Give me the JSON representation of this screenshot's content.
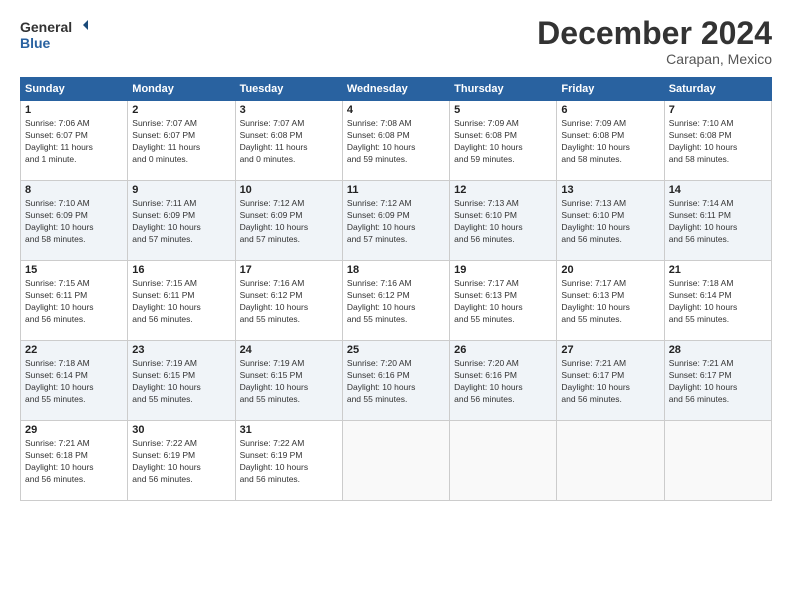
{
  "logo": {
    "line1": "General",
    "line2": "Blue"
  },
  "title": "December 2024",
  "subtitle": "Carapan, Mexico",
  "days_header": [
    "Sunday",
    "Monday",
    "Tuesday",
    "Wednesday",
    "Thursday",
    "Friday",
    "Saturday"
  ],
  "weeks": [
    [
      {
        "num": "1",
        "info": "Sunrise: 7:06 AM\nSunset: 6:07 PM\nDaylight: 11 hours\nand 1 minute."
      },
      {
        "num": "2",
        "info": "Sunrise: 7:07 AM\nSunset: 6:07 PM\nDaylight: 11 hours\nand 0 minutes."
      },
      {
        "num": "3",
        "info": "Sunrise: 7:07 AM\nSunset: 6:08 PM\nDaylight: 11 hours\nand 0 minutes."
      },
      {
        "num": "4",
        "info": "Sunrise: 7:08 AM\nSunset: 6:08 PM\nDaylight: 10 hours\nand 59 minutes."
      },
      {
        "num": "5",
        "info": "Sunrise: 7:09 AM\nSunset: 6:08 PM\nDaylight: 10 hours\nand 59 minutes."
      },
      {
        "num": "6",
        "info": "Sunrise: 7:09 AM\nSunset: 6:08 PM\nDaylight: 10 hours\nand 58 minutes."
      },
      {
        "num": "7",
        "info": "Sunrise: 7:10 AM\nSunset: 6:08 PM\nDaylight: 10 hours\nand 58 minutes."
      }
    ],
    [
      {
        "num": "8",
        "info": "Sunrise: 7:10 AM\nSunset: 6:09 PM\nDaylight: 10 hours\nand 58 minutes."
      },
      {
        "num": "9",
        "info": "Sunrise: 7:11 AM\nSunset: 6:09 PM\nDaylight: 10 hours\nand 57 minutes."
      },
      {
        "num": "10",
        "info": "Sunrise: 7:12 AM\nSunset: 6:09 PM\nDaylight: 10 hours\nand 57 minutes."
      },
      {
        "num": "11",
        "info": "Sunrise: 7:12 AM\nSunset: 6:09 PM\nDaylight: 10 hours\nand 57 minutes."
      },
      {
        "num": "12",
        "info": "Sunrise: 7:13 AM\nSunset: 6:10 PM\nDaylight: 10 hours\nand 56 minutes."
      },
      {
        "num": "13",
        "info": "Sunrise: 7:13 AM\nSunset: 6:10 PM\nDaylight: 10 hours\nand 56 minutes."
      },
      {
        "num": "14",
        "info": "Sunrise: 7:14 AM\nSunset: 6:11 PM\nDaylight: 10 hours\nand 56 minutes."
      }
    ],
    [
      {
        "num": "15",
        "info": "Sunrise: 7:15 AM\nSunset: 6:11 PM\nDaylight: 10 hours\nand 56 minutes."
      },
      {
        "num": "16",
        "info": "Sunrise: 7:15 AM\nSunset: 6:11 PM\nDaylight: 10 hours\nand 56 minutes."
      },
      {
        "num": "17",
        "info": "Sunrise: 7:16 AM\nSunset: 6:12 PM\nDaylight: 10 hours\nand 55 minutes."
      },
      {
        "num": "18",
        "info": "Sunrise: 7:16 AM\nSunset: 6:12 PM\nDaylight: 10 hours\nand 55 minutes."
      },
      {
        "num": "19",
        "info": "Sunrise: 7:17 AM\nSunset: 6:13 PM\nDaylight: 10 hours\nand 55 minutes."
      },
      {
        "num": "20",
        "info": "Sunrise: 7:17 AM\nSunset: 6:13 PM\nDaylight: 10 hours\nand 55 minutes."
      },
      {
        "num": "21",
        "info": "Sunrise: 7:18 AM\nSunset: 6:14 PM\nDaylight: 10 hours\nand 55 minutes."
      }
    ],
    [
      {
        "num": "22",
        "info": "Sunrise: 7:18 AM\nSunset: 6:14 PM\nDaylight: 10 hours\nand 55 minutes."
      },
      {
        "num": "23",
        "info": "Sunrise: 7:19 AM\nSunset: 6:15 PM\nDaylight: 10 hours\nand 55 minutes."
      },
      {
        "num": "24",
        "info": "Sunrise: 7:19 AM\nSunset: 6:15 PM\nDaylight: 10 hours\nand 55 minutes."
      },
      {
        "num": "25",
        "info": "Sunrise: 7:20 AM\nSunset: 6:16 PM\nDaylight: 10 hours\nand 55 minutes."
      },
      {
        "num": "26",
        "info": "Sunrise: 7:20 AM\nSunset: 6:16 PM\nDaylight: 10 hours\nand 56 minutes."
      },
      {
        "num": "27",
        "info": "Sunrise: 7:21 AM\nSunset: 6:17 PM\nDaylight: 10 hours\nand 56 minutes."
      },
      {
        "num": "28",
        "info": "Sunrise: 7:21 AM\nSunset: 6:17 PM\nDaylight: 10 hours\nand 56 minutes."
      }
    ],
    [
      {
        "num": "29",
        "info": "Sunrise: 7:21 AM\nSunset: 6:18 PM\nDaylight: 10 hours\nand 56 minutes."
      },
      {
        "num": "30",
        "info": "Sunrise: 7:22 AM\nSunset: 6:19 PM\nDaylight: 10 hours\nand 56 minutes."
      },
      {
        "num": "31",
        "info": "Sunrise: 7:22 AM\nSunset: 6:19 PM\nDaylight: 10 hours\nand 56 minutes."
      },
      {
        "num": "",
        "info": ""
      },
      {
        "num": "",
        "info": ""
      },
      {
        "num": "",
        "info": ""
      },
      {
        "num": "",
        "info": ""
      }
    ]
  ]
}
